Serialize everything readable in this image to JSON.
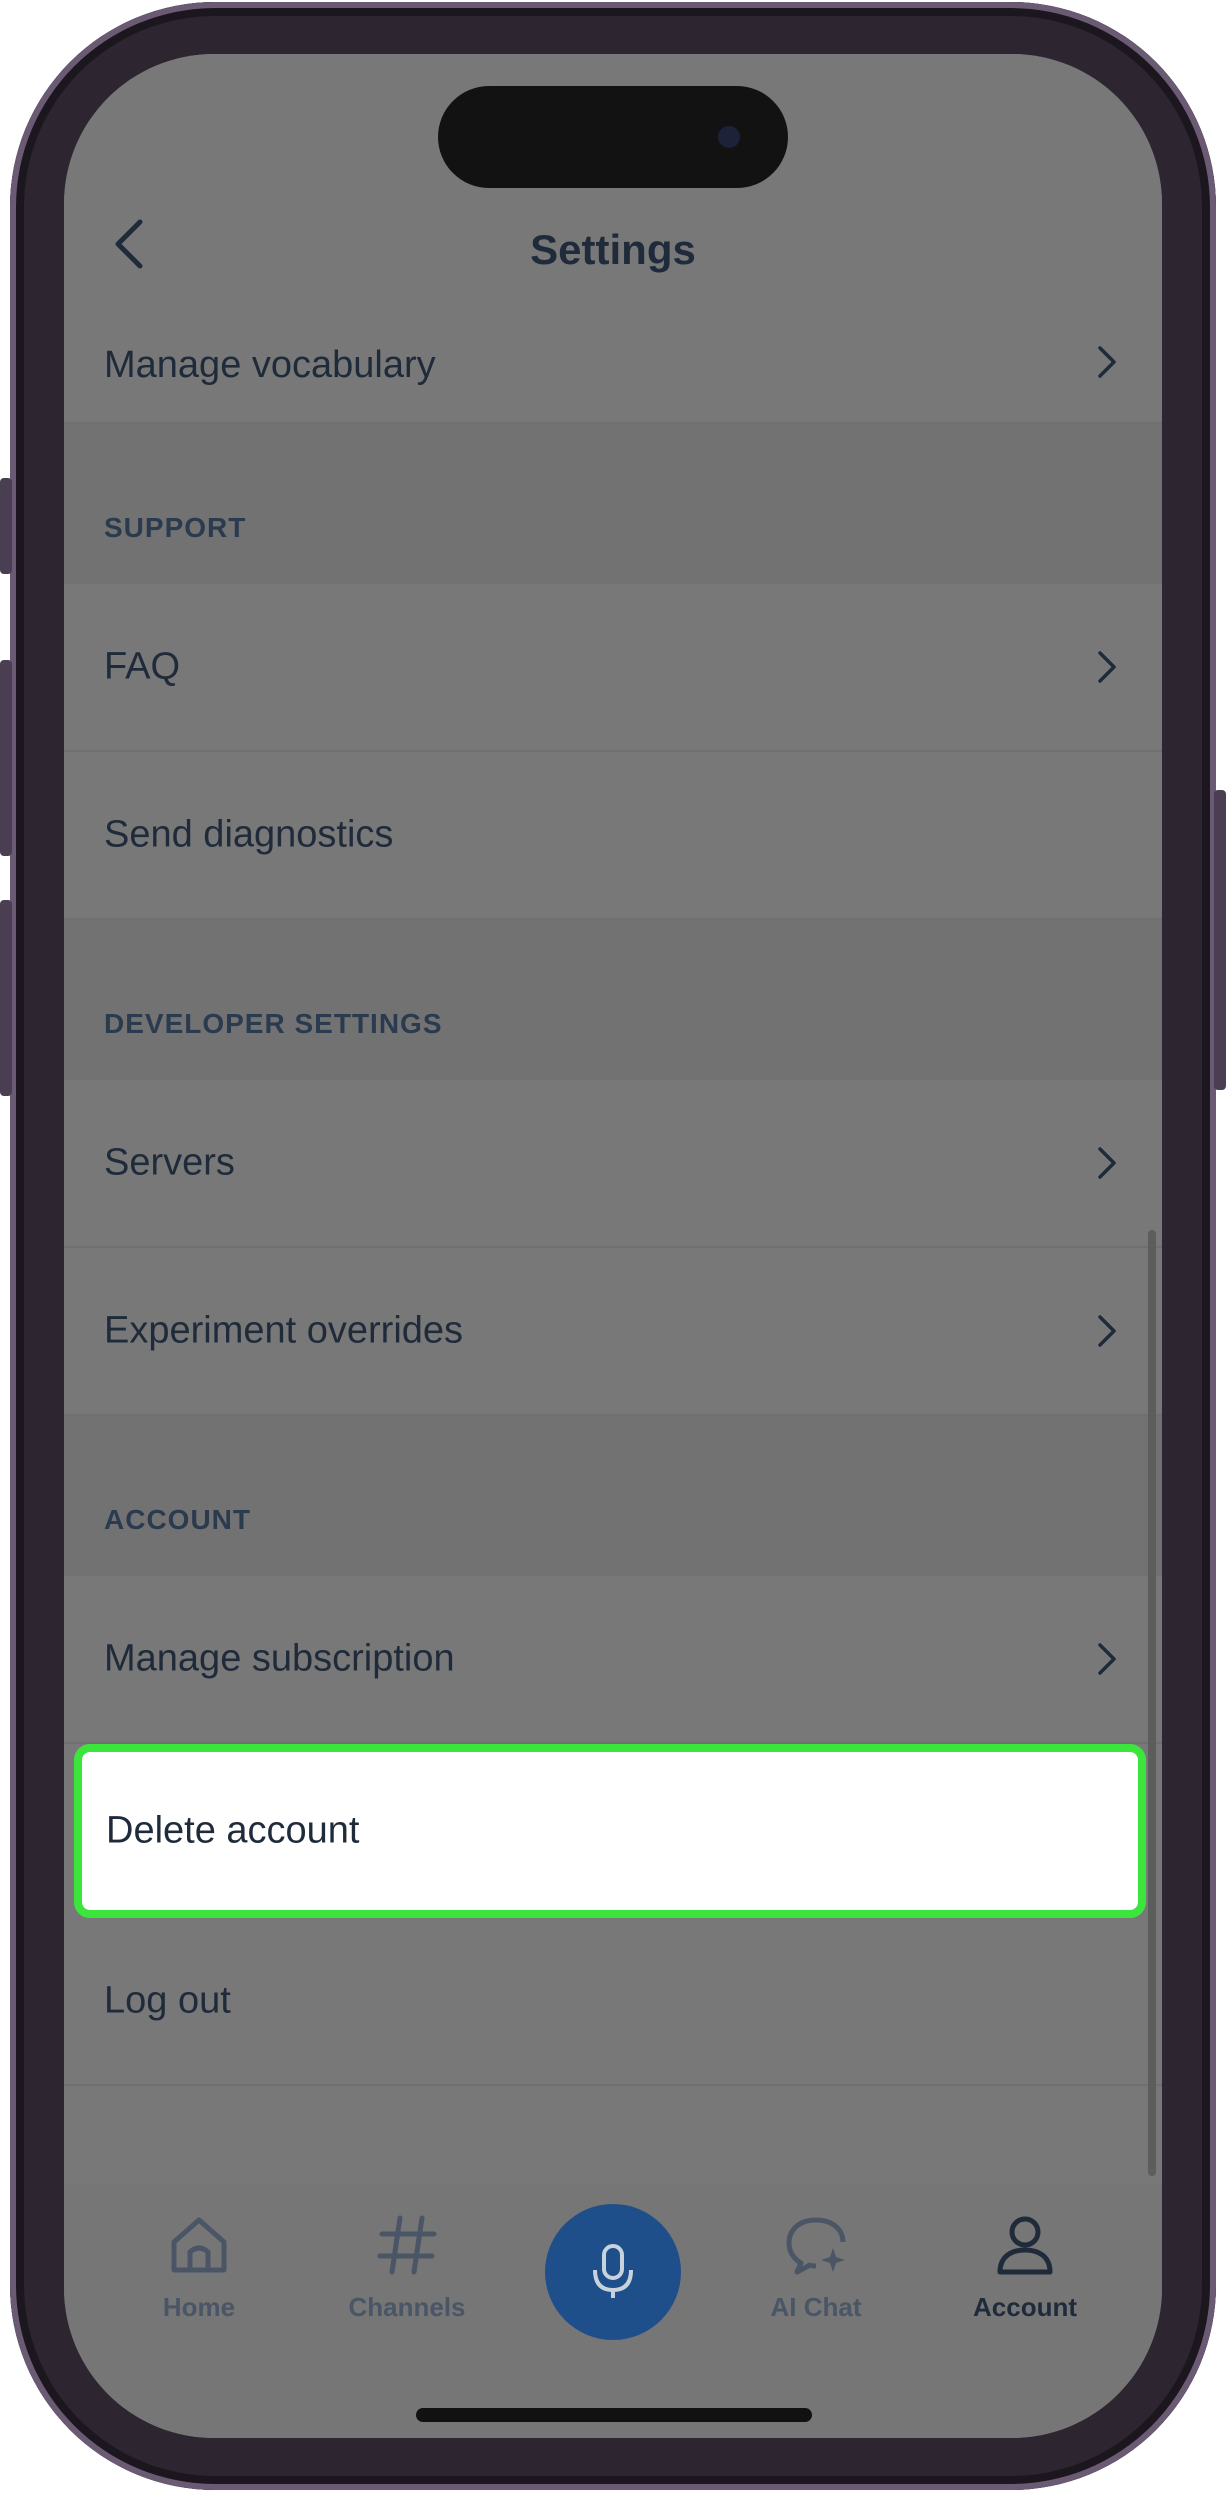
{
  "header": {
    "title": "Settings"
  },
  "rows": {
    "manage_vocabulary": "Manage vocabulary",
    "faq": "FAQ",
    "send_diagnostics": "Send diagnostics",
    "servers": "Servers",
    "experiment_overrides": "Experiment overrides",
    "manage_subscription": "Manage subscription",
    "delete_account": "Delete account",
    "log_out": "Log out"
  },
  "sections": {
    "support": "SUPPORT",
    "developer_settings": "DEVELOPER SETTINGS",
    "account": "ACCOUNT"
  },
  "tabbar": {
    "home": "Home",
    "channels": "Channels",
    "ai_chat": "AI Chat",
    "account": "Account",
    "active": "Account"
  },
  "colors": {
    "highlight_border": "#3ce53c",
    "mic_button": "#1f4f8a",
    "text": "#1f2b3a"
  },
  "icons": [
    "back-icon",
    "chevron-right-icon",
    "home-icon",
    "hashtag-icon",
    "microphone-icon",
    "ai-chat-icon",
    "account-icon"
  ]
}
